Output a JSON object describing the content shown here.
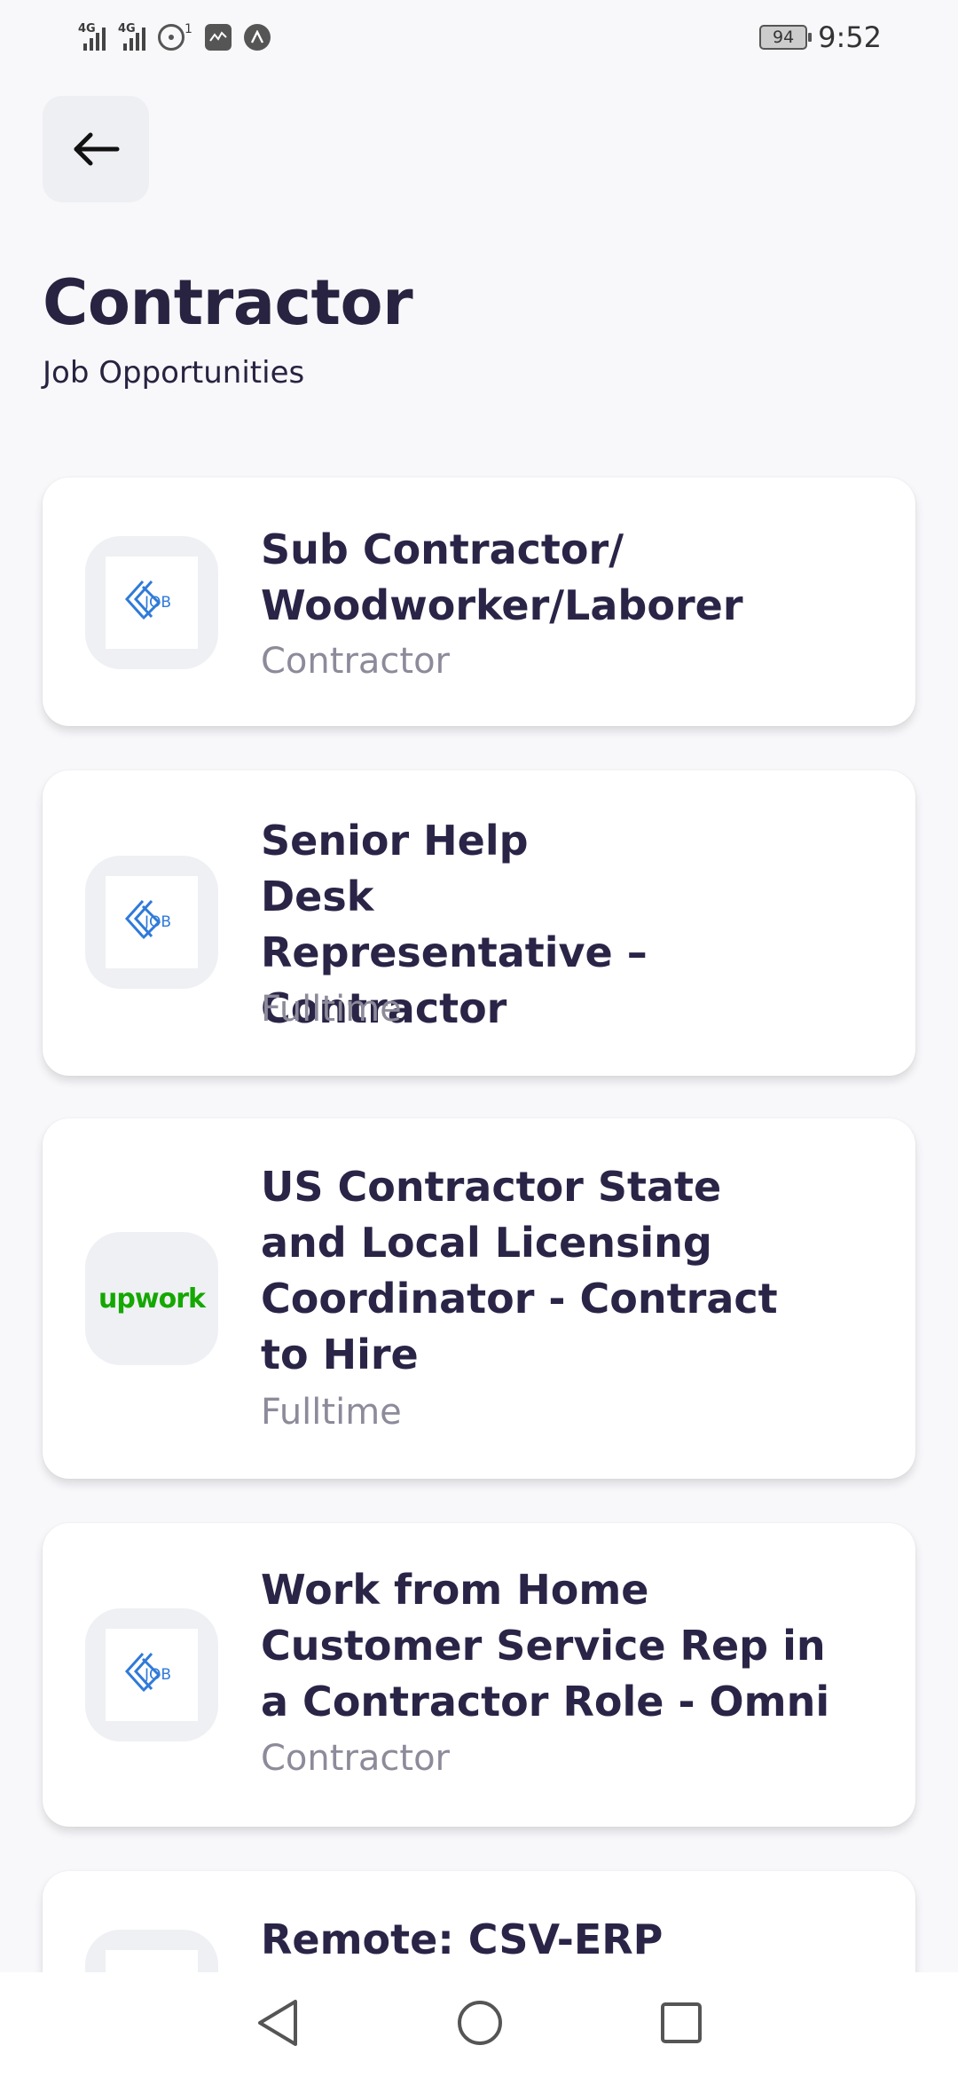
{
  "status_bar": {
    "signal_1": "4G",
    "signal_2": "4G",
    "hotspot_count": "1",
    "battery": "94",
    "time": "9:52"
  },
  "header": {
    "back_icon": "arrow-left-icon",
    "title": "Contractor",
    "subtitle": "Job Opportunities"
  },
  "jobs": [
    {
      "logo": "job-logo",
      "title": "Sub Contractor/ Woodworker/Laborer",
      "type": "Contractor"
    },
    {
      "logo": "job-logo",
      "title": "Senior Help Desk Representative – Contractor",
      "type": "Fulltime"
    },
    {
      "logo": "upwork",
      "logo_text": "upwork",
      "title": "US Contractor State and Local Licensing Coordinator - Contract to Hire",
      "type": "Fulltime"
    },
    {
      "logo": "job-logo",
      "title": "Work from Home Customer Service Rep in a Contractor Role - Omni",
      "type": "Contractor"
    },
    {
      "logo": "job-logo",
      "title": "Remote: CSV-ERP",
      "type": ""
    }
  ],
  "colors": {
    "background": "#f8f8fb",
    "title": "#272340",
    "muted": "#8d8a9a",
    "job_logo_blue": "#2f7ad9",
    "upwork_green": "#14a800"
  },
  "nav": {
    "back_icon": "triangle-back-icon",
    "home_icon": "circle-home-icon",
    "recents_icon": "square-recents-icon"
  }
}
